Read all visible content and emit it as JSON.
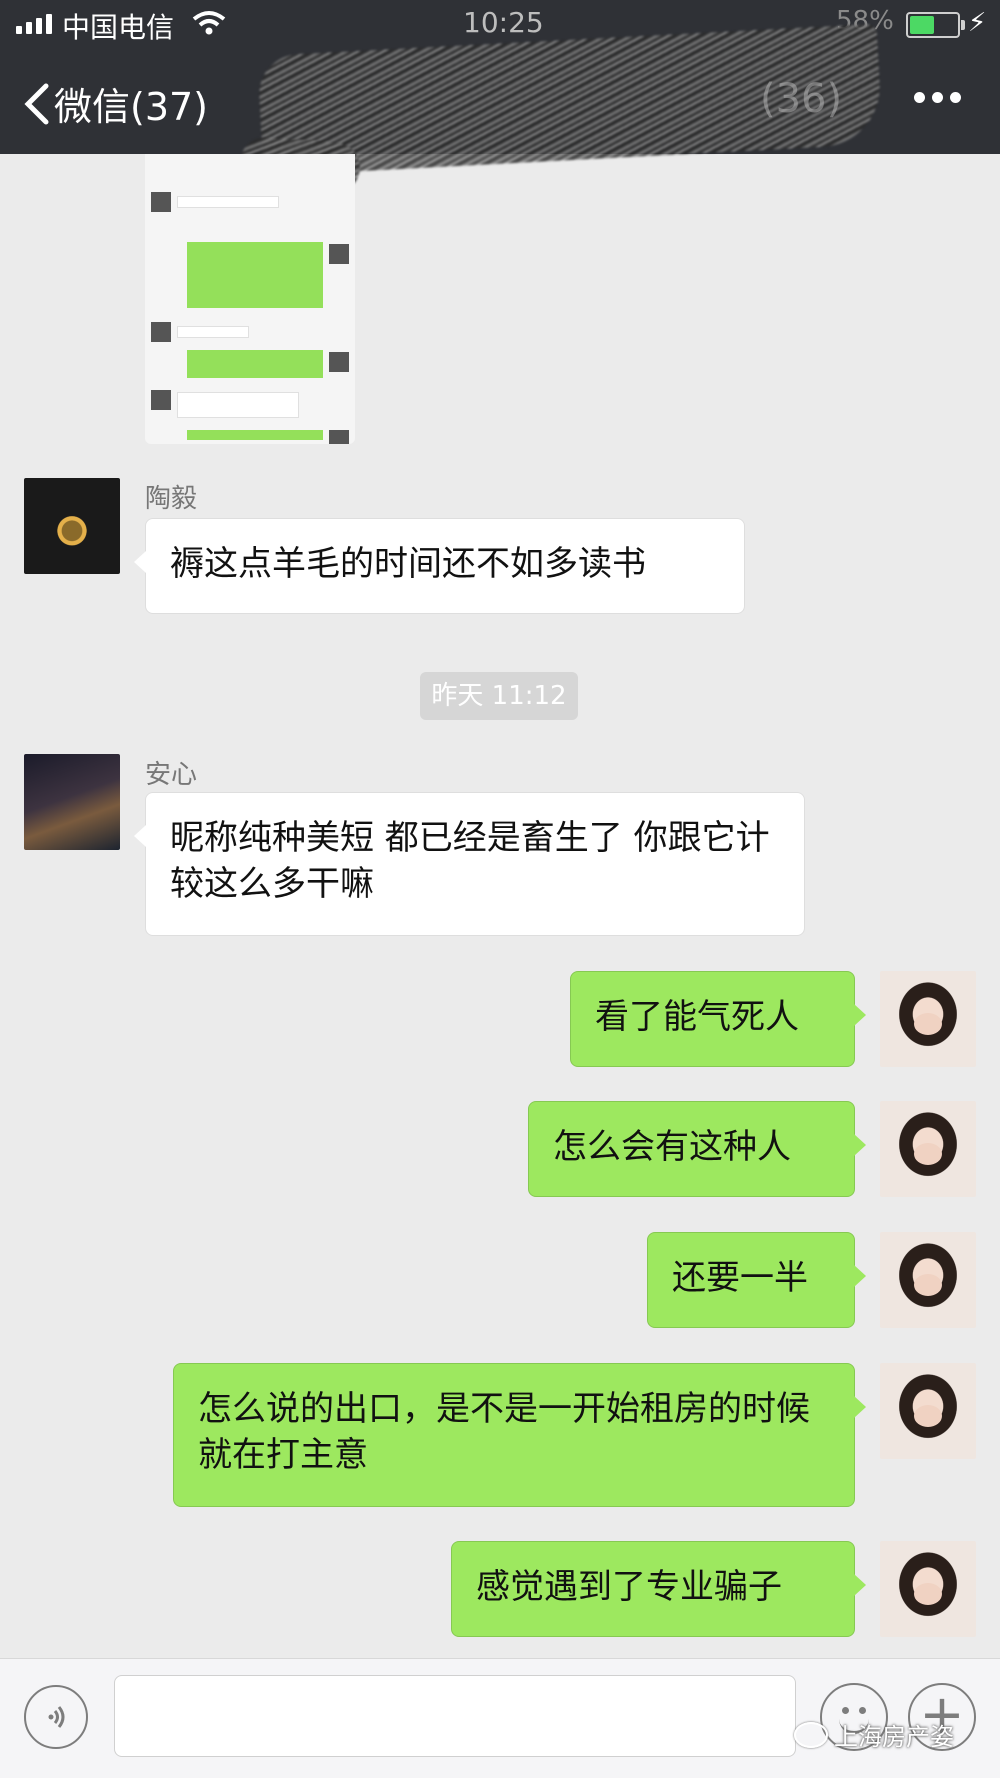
{
  "status": {
    "carrier": "中国电信",
    "time": "10:25",
    "battery_pct": "58%",
    "battery_level": 0.58
  },
  "nav": {
    "back_label": "微信(37)",
    "chat_title_visible": "(36)"
  },
  "messages": [
    {
      "sender": "陶毅",
      "side": "left",
      "text": "褥这点羊毛的时间还不如多读书"
    },
    {
      "timestamp": "昨天 11:12"
    },
    {
      "sender": "安心",
      "side": "left",
      "text": "昵称纯种美短 都已经是畜生了 你跟它计较这么多干嘛"
    },
    {
      "side": "right",
      "text": "看了能气死人"
    },
    {
      "side": "right",
      "text": "怎么会有这种人"
    },
    {
      "side": "right",
      "text": "还要一半"
    },
    {
      "side": "right",
      "text": "怎么说的出口，是不是一开始租房的时候就在打主意"
    },
    {
      "side": "right",
      "text": "感觉遇到了专业骗子"
    }
  ],
  "watermark": "上海房产姿",
  "icons": {
    "back": "chevron-left-icon",
    "more": "more-dots-icon",
    "voice": "voice-icon",
    "emoji": "emoji-icon",
    "plus": "plus-icon"
  }
}
